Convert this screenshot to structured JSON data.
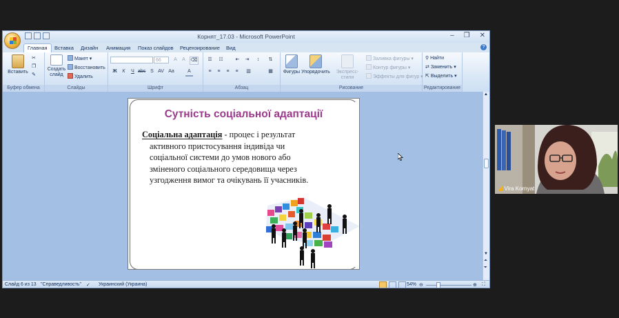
{
  "window": {
    "title": "Корнят_17.03 - Microsoft PowerPoint",
    "controls": [
      "minimize-icon",
      "restore-icon",
      "close-icon"
    ]
  },
  "ribbon": {
    "tabs": [
      "Главная",
      "Вставка",
      "Дизайн",
      "Анимация",
      "Показ слайдов",
      "Рецензирование",
      "Вид"
    ],
    "active_tab": "Главная",
    "groups": {
      "clipboard": {
        "label": "Буфер обмена",
        "paste": "Вставить"
      },
      "slides": {
        "label": "Слайды",
        "new_slide_line1": "Создать",
        "new_slide_line2": "слайд",
        "layout": "Макет",
        "reset": "Восстановить",
        "delete": "Удалить"
      },
      "font": {
        "label": "Шрифт",
        "font_name": "",
        "font_size": "66"
      },
      "paragraph": {
        "label": "Абзац"
      },
      "drawing": {
        "label": "Рисование",
        "shapes": "Фигуры",
        "arrange": "Упорядочить",
        "quick_styles": "Экспресс-стили",
        "fill": "Заливка фигуры",
        "outline": "Контур фигуры",
        "effects": "Эффекты для фигур"
      },
      "editing": {
        "label": "Редактирование",
        "find": "Найти",
        "replace": "Заменить",
        "select": "Выделить"
      }
    }
  },
  "slide": {
    "title": "Сутність соціальної адаптації",
    "term": "Соціальна адаптація",
    "lines": [
      " - процес і результат",
      "активного пристосування індивіда чи",
      "соціальної системи до умов нового або",
      "зміненого соціального середовища через",
      "узгодження вимог та очікувань її учасників."
    ]
  },
  "status": {
    "slide_of": "Слайд 6 из 13",
    "theme": "\"Справедливость\"",
    "language": "Украинский (Украина)",
    "zoom": "54%"
  },
  "video": {
    "participant_name": "Vira Kornyat"
  },
  "colors": {
    "slide_title": "#9b3a8c",
    "workspace": "#a3bfe3",
    "ribbon": "#dbe8f6"
  }
}
